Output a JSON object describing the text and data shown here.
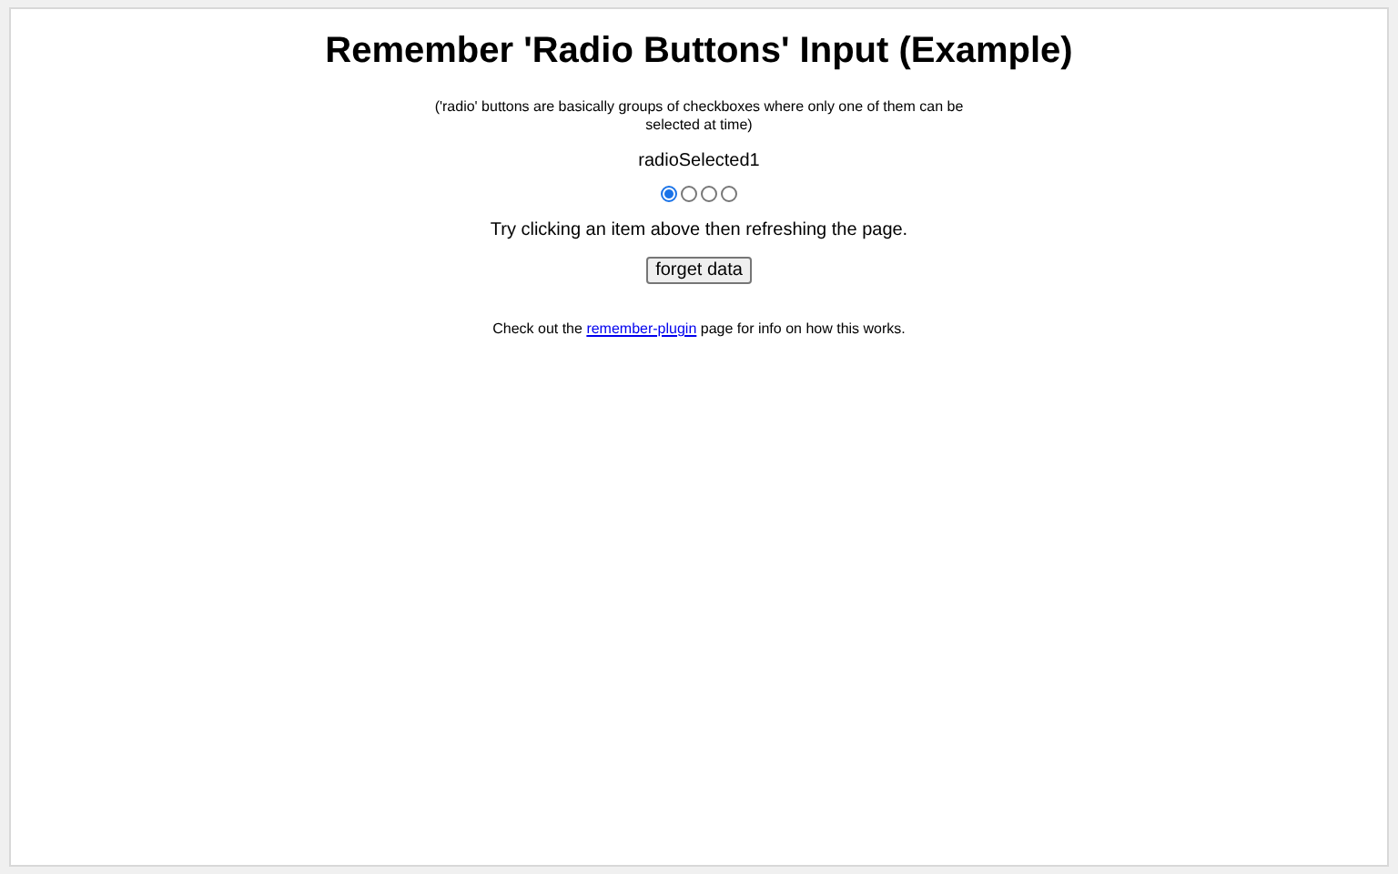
{
  "title": "Remember 'Radio Buttons' Input (Example)",
  "note": "('radio' buttons are basically groups of checkboxes where only one of them can be selected at time)",
  "selected_label": "radioSelected1",
  "radios": [
    {
      "selected": true
    },
    {
      "selected": false
    },
    {
      "selected": false
    },
    {
      "selected": false
    }
  ],
  "instruction": "Try clicking an item above then refreshing the page.",
  "button": "forget data",
  "footer": {
    "before": "Check out the",
    "link": "remember-plugin",
    "after": "page for info on how this works."
  }
}
